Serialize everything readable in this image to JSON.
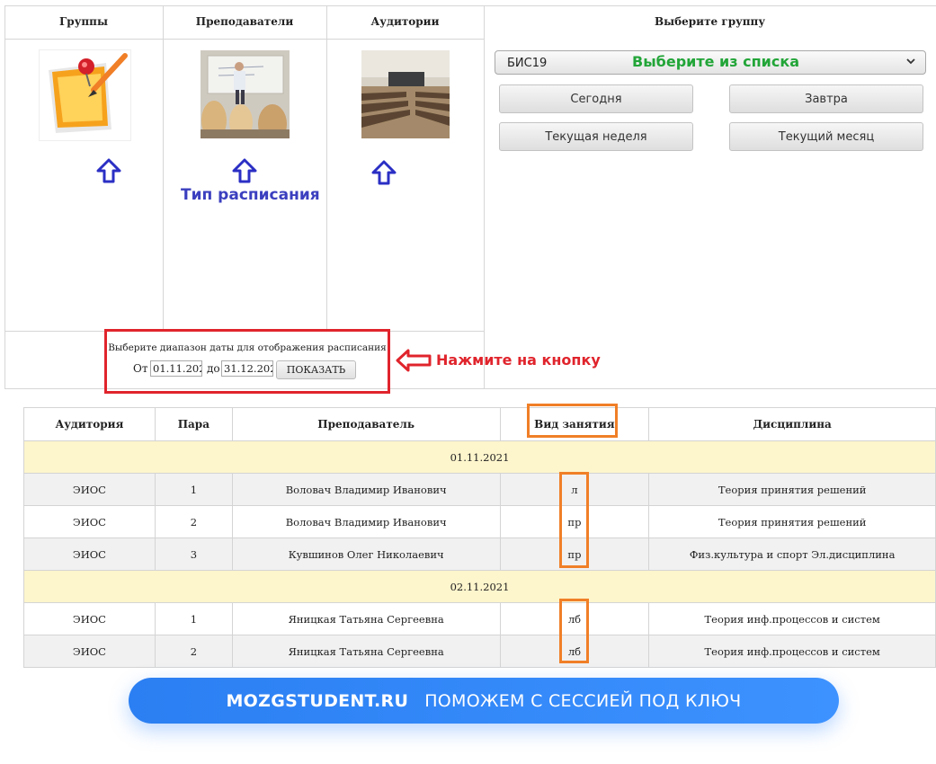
{
  "columns": {
    "groups": "Группы",
    "teachers": "Преподаватели",
    "rooms": "Аудитории",
    "select_group": "Выберите группу"
  },
  "annotations": {
    "schedule_type": "Тип расписания",
    "choose_from_list": "Выберите из списка",
    "press_button": "Нажмите на кнопку"
  },
  "group_select": {
    "value": "БИС19"
  },
  "quick_buttons": {
    "today": "Сегодня",
    "tomorrow": "Завтра",
    "current_week": "Текущая неделя",
    "current_month": "Текущий месяц"
  },
  "date_range": {
    "title": "Выберите диапазон даты для отображения расписания",
    "from_label": "От",
    "from_value": "01.11.202",
    "to_label": "до",
    "to_value": "31.12.202",
    "show_button": "ПОКАЗАТЬ"
  },
  "schedule": {
    "headers": [
      "Аудитория",
      "Пара",
      "Преподаватель",
      "Вид занятия",
      "Дисциплина"
    ],
    "days": [
      {
        "date": "01.11.2021",
        "rows": [
          [
            "ЭИОС",
            "1",
            "Воловач Владимир Иванович",
            "л",
            "Теория принятия решений"
          ],
          [
            "ЭИОС",
            "2",
            "Воловач Владимир Иванович",
            "пр",
            "Теория принятия решений"
          ],
          [
            "ЭИОС",
            "3",
            "Кувшинов Олег Николаевич",
            "пр",
            "Физ.культура и спорт Эл.дисциплина"
          ]
        ]
      },
      {
        "date": "02.11.2021",
        "rows": [
          [
            "ЭИОС",
            "1",
            "Яницкая Татьяна Сергеевна",
            "лб",
            "Теория инф.процессов и систем"
          ],
          [
            "ЭИОС",
            "2",
            "Яницкая Татьяна Сергеевна",
            "лб",
            "Теория инф.процессов и систем"
          ]
        ]
      }
    ]
  },
  "banner": {
    "brand": "MOZGSTUDENT.RU",
    "slogan": "ПОМОЖЕМ С СЕССИЕЙ ПОД КЛЮЧ"
  },
  "colors": {
    "annotation_blue": "#3b3fbf",
    "annotation_green": "#22a538",
    "annotation_red": "#e0242c",
    "highlight_orange": "#f07f27",
    "date_row": "#fdf5cc",
    "banner": "#3388f8"
  }
}
